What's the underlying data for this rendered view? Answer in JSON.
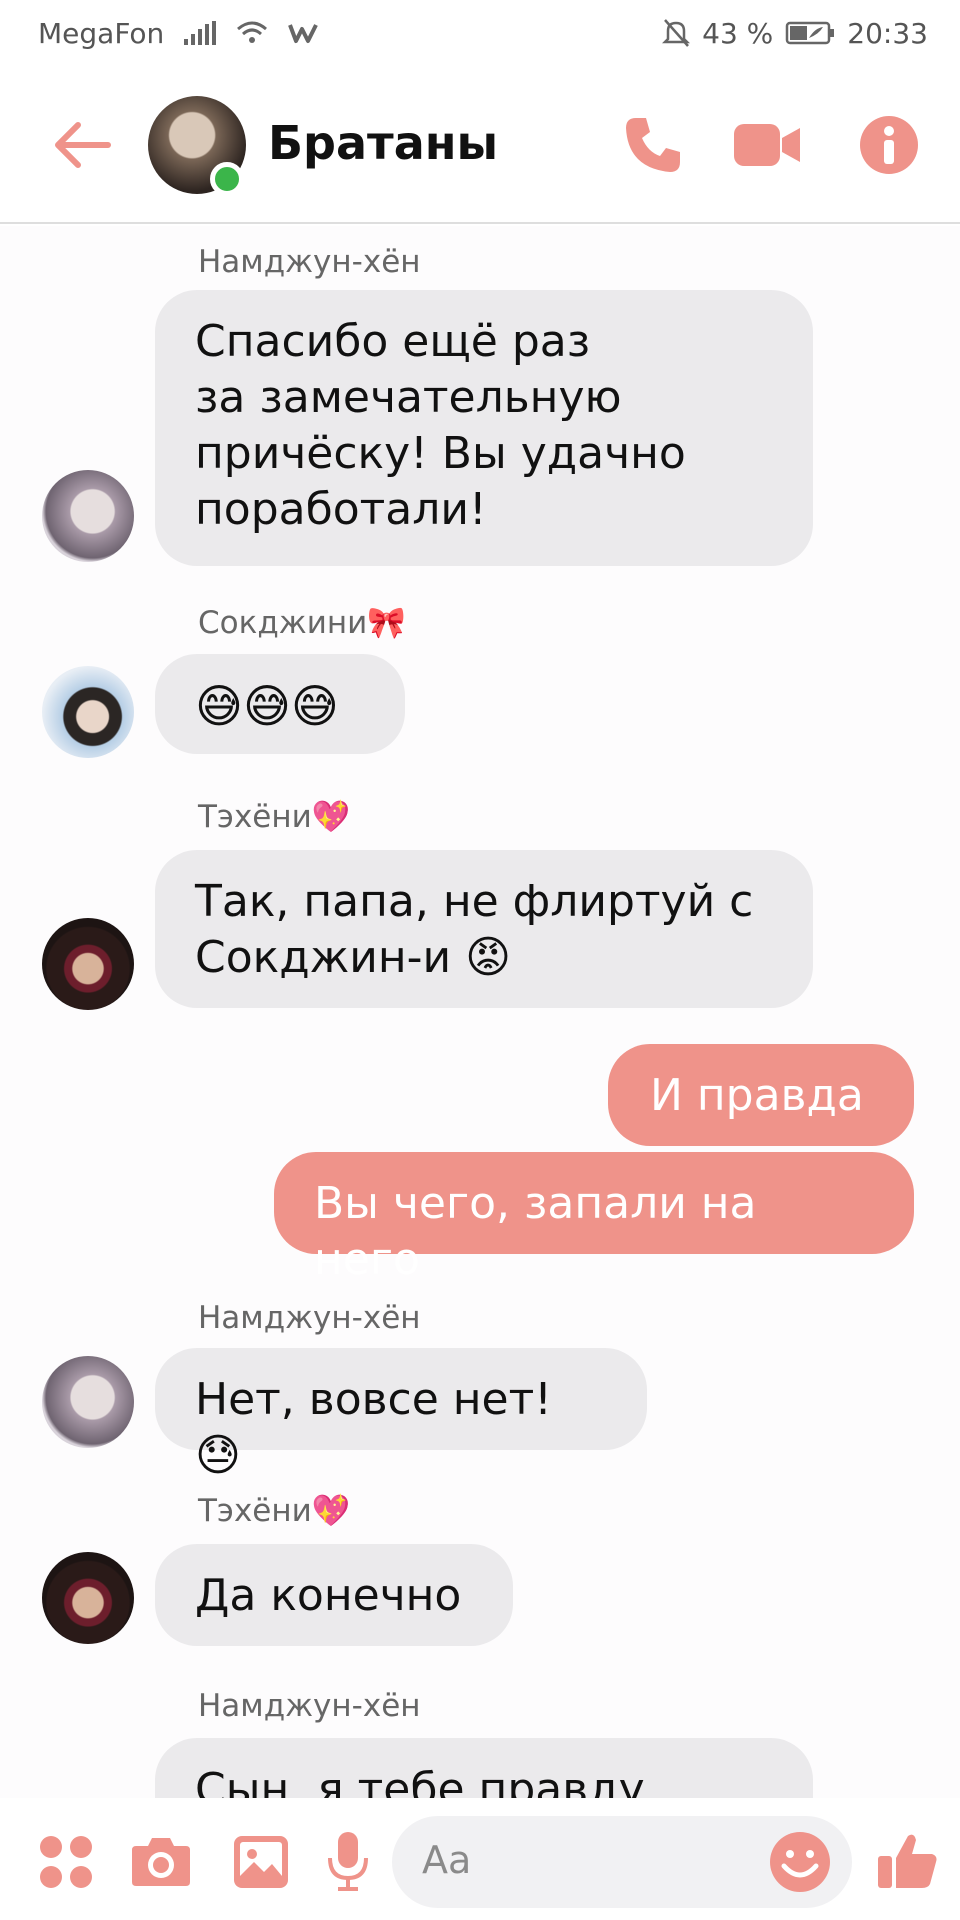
{
  "status_bar": {
    "carrier": "MegaFon",
    "battery_percent": "43 %",
    "time": "20:33",
    "icons": [
      "signal-icon",
      "wifi-icon",
      "w-app-icon",
      "muted-bell-icon",
      "battery-icon"
    ]
  },
  "header": {
    "title": "Братаны",
    "online": true,
    "icons": [
      "back-arrow-icon",
      "phone-icon",
      "video-icon",
      "info-icon"
    ]
  },
  "messages": [
    {
      "sender": "Намджун-хён",
      "lines": [
        "Спасибо ещё раз",
        "за замечательную",
        "причёску! Вы удачно",
        "поработали!"
      ]
    },
    {
      "sender": "Сокджини🎀",
      "text": "😅😅😅"
    },
    {
      "sender": "Тэхёни💖",
      "lines": [
        "Так, папа, не флиртуй с",
        "Сокджин-и 😡"
      ]
    },
    {
      "outgoing": true,
      "text": "И правда"
    },
    {
      "outgoing": true,
      "text": "Вы чего, запали на него"
    },
    {
      "sender": "Намджун-хён",
      "text": "Нет, вовсе нет! 😓"
    },
    {
      "sender": "Тэхёни💖",
      "text": "Да конечно"
    },
    {
      "sender": "Намджун-хён",
      "text": "Сын, я тебе правду"
    }
  ],
  "composer": {
    "placeholder": "Aa",
    "icons": [
      "apps-icon",
      "camera-icon",
      "gallery-icon",
      "microphone-icon",
      "emoji-icon",
      "like-icon"
    ]
  },
  "colors": {
    "accent": "#ef938a",
    "incoming_bubble": "#ebeaec",
    "online": "#3bb54a"
  }
}
